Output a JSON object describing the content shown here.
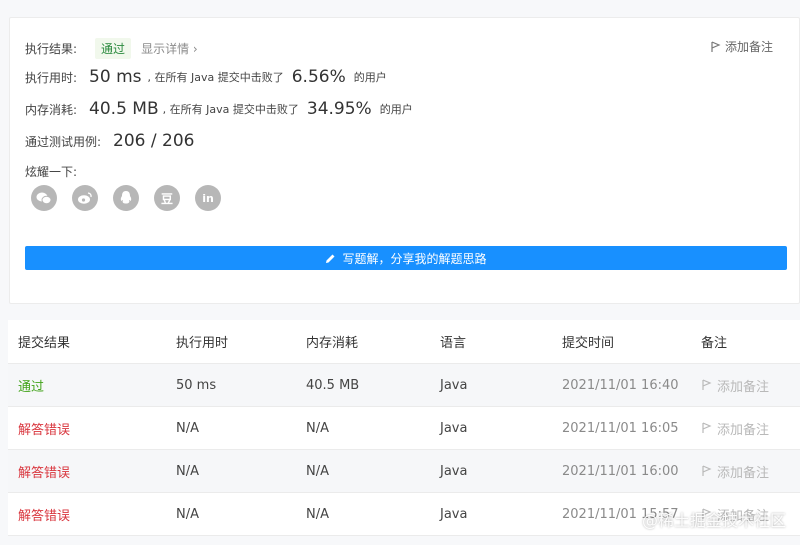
{
  "result": {
    "exec_result_label": "执行结果:",
    "status": "通过",
    "details_link": "显示详情 ›",
    "add_note": "添加备注"
  },
  "runtime": {
    "label": "执行用时:",
    "value": "50 ms",
    "mid": ", 在所有 Java 提交中击败了",
    "percent": "6.56%",
    "suffix": "的用户"
  },
  "memory": {
    "label": "内存消耗:",
    "value": "40.5 MB",
    "mid": ", 在所有 Java 提交中击败了",
    "percent": "34.95%",
    "suffix": "的用户"
  },
  "tests": {
    "label": "通过测试用例:",
    "value": "206 / 206"
  },
  "share": {
    "label": "炫耀一下:",
    "icons": [
      "wechat-icon",
      "weibo-icon",
      "qq-icon",
      "douban-icon",
      "linkedin-icon"
    ]
  },
  "write_solution": "写题解，分享我的解题思路",
  "table": {
    "headers": [
      "提交结果",
      "执行用时",
      "内存消耗",
      "语言",
      "提交时间",
      "备注"
    ],
    "rows": [
      {
        "result": "通过",
        "runtime": "50 ms",
        "memory": "40.5 MB",
        "lang": "Java",
        "time": "2021/11/01 16:40",
        "note": "添加备注"
      },
      {
        "result": "解答错误",
        "runtime": "N/A",
        "memory": "N/A",
        "lang": "Java",
        "time": "2021/11/01 16:05",
        "note": "添加备注"
      },
      {
        "result": "解答错误",
        "runtime": "N/A",
        "memory": "N/A",
        "lang": "Java",
        "time": "2021/11/01 16:00",
        "note": "添加备注"
      },
      {
        "result": "解答错误",
        "runtime": "N/A",
        "memory": "N/A",
        "lang": "Java",
        "time": "2021/11/01 15:57",
        "note": "添加备注"
      }
    ]
  },
  "watermark": "@稀土掘金技术社区",
  "colors": {
    "accent": "#1890ff",
    "success": "#42a31a",
    "error": "#d9363e"
  }
}
